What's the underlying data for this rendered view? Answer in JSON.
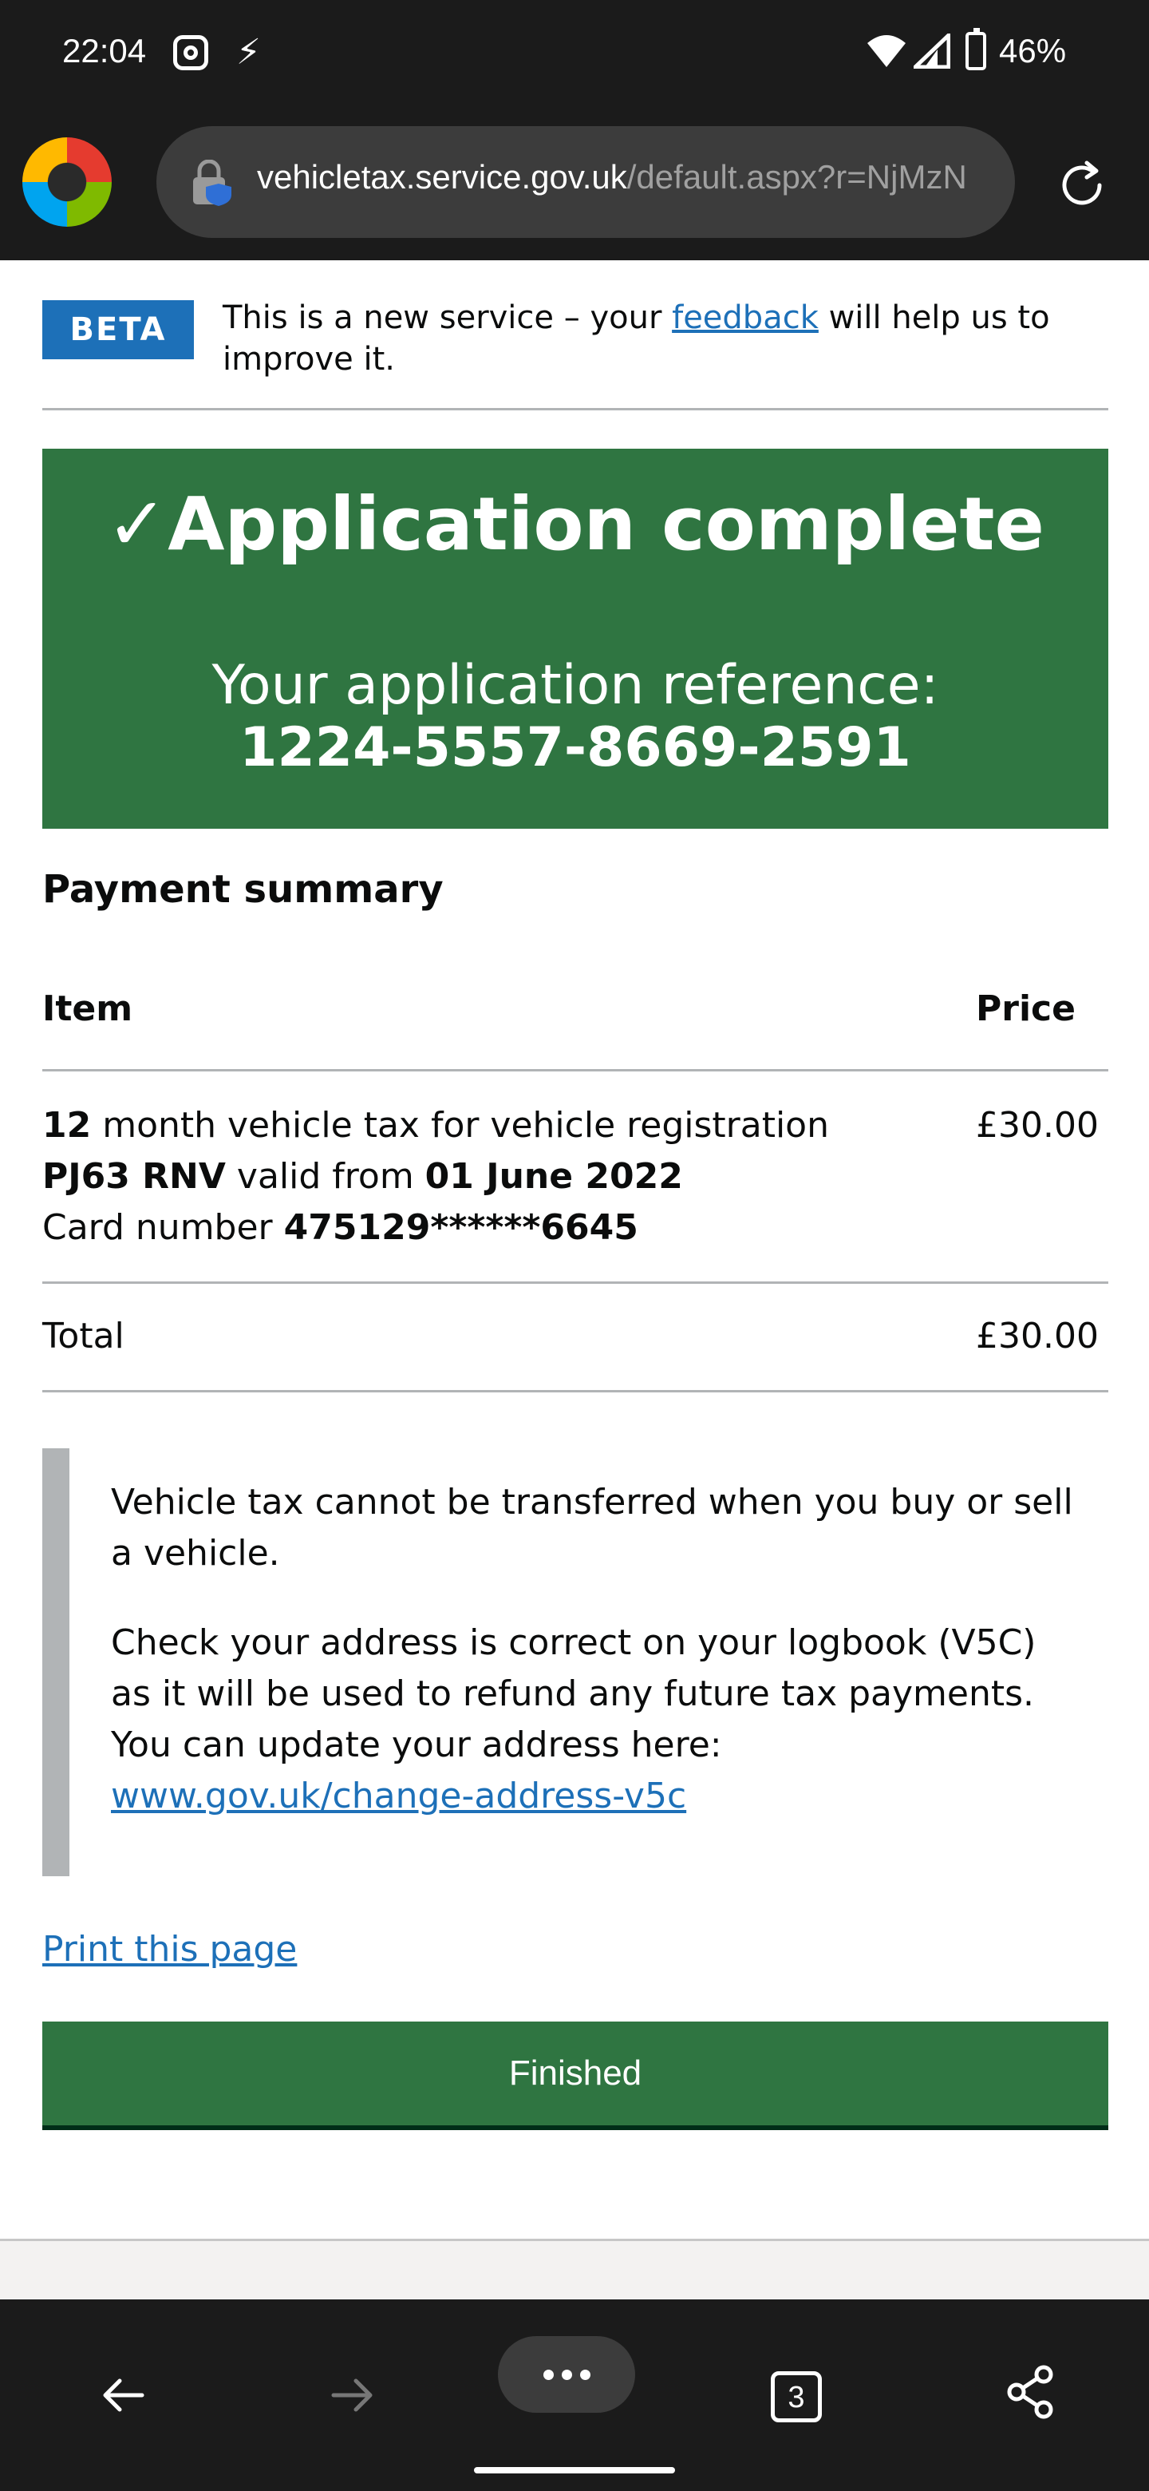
{
  "status_bar": {
    "time": "22:04",
    "battery": "46%"
  },
  "browser": {
    "url_host": "vehicletax.service.gov.uk",
    "url_path": "/default.aspx?r=NjMzN",
    "open_tabs": "3"
  },
  "beta_banner": {
    "tag": "BETA",
    "text_before": "This is a new service – your ",
    "link": "feedback",
    "text_after": " will help us to improve it."
  },
  "confirmation": {
    "check": "✓",
    "title": "Application complete",
    "reference_label": "Your application reference: ",
    "reference_number": "1224-5557-8669-2591"
  },
  "payment_summary": {
    "heading": "Payment summary",
    "columns": {
      "item": "Item",
      "price": "Price"
    },
    "row": {
      "months": "12",
      "text1": " month vehicle tax for vehicle registration ",
      "registration": "PJ63 RNV",
      "text2": " valid from ",
      "valid_from": "01 June 2022",
      "card_label": "Card number ",
      "card_number": "475129******6645",
      "price": "£30.00"
    },
    "total_label": "Total",
    "total_value": "£30.00"
  },
  "inset": {
    "p1": "Vehicle tax cannot be transferred when you buy or sell a vehicle.",
    "p2": "Check your address is correct on your logbook (V5C) as it will be used to refund any future tax payments. You can update your address here: ",
    "link": "www.gov.uk/change-address-v5c"
  },
  "print_link": "Print this page",
  "finished_button": "Finished",
  "colors": {
    "govuk_green": "#2f7541",
    "govuk_blue": "#1d70b8",
    "border_grey": "#b1b4b6"
  }
}
